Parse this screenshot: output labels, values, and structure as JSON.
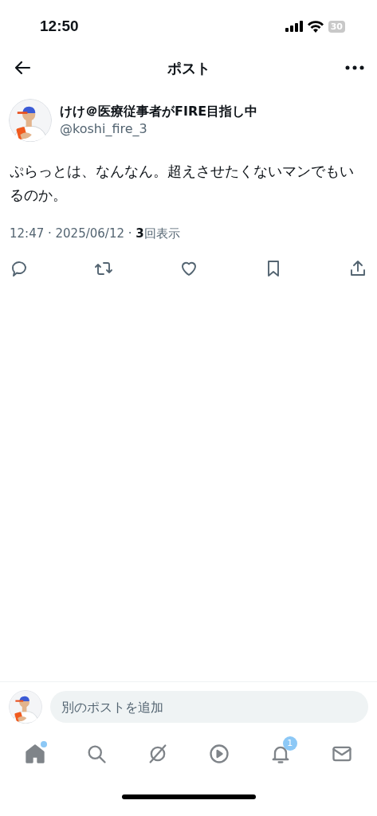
{
  "status_bar": {
    "time": "12:50",
    "battery": "30"
  },
  "header": {
    "title": "ポスト"
  },
  "post": {
    "author_name": "けけ＠医療従事者がFIRE目指し中",
    "handle": "@koshi_fire_3",
    "text": "ぷらっとは、なんなん。超えさせたくないマンでもいるのか。",
    "meta": "12:47 · 2025/06/12 · **3**回表示"
  },
  "actions": [
    {
      "kind": "reply"
    },
    {
      "kind": "repost"
    },
    {
      "kind": "like"
    },
    {
      "kind": "bookmark"
    },
    {
      "kind": "share"
    }
  ],
  "composer": {
    "placeholder": "別のポストを追加"
  },
  "tab_bar": [
    {
      "kind": "home",
      "selected": true,
      "dot": true
    },
    {
      "kind": "search",
      "selected": false,
      "dot": false
    },
    {
      "kind": "grok",
      "selected": false,
      "dot": false
    },
    {
      "kind": "video",
      "selected": false,
      "dot": false
    },
    {
      "kind": "notifications",
      "selected": false,
      "dot": false,
      "badge": "1"
    },
    {
      "kind": "messages",
      "selected": false,
      "dot": false
    }
  ]
}
